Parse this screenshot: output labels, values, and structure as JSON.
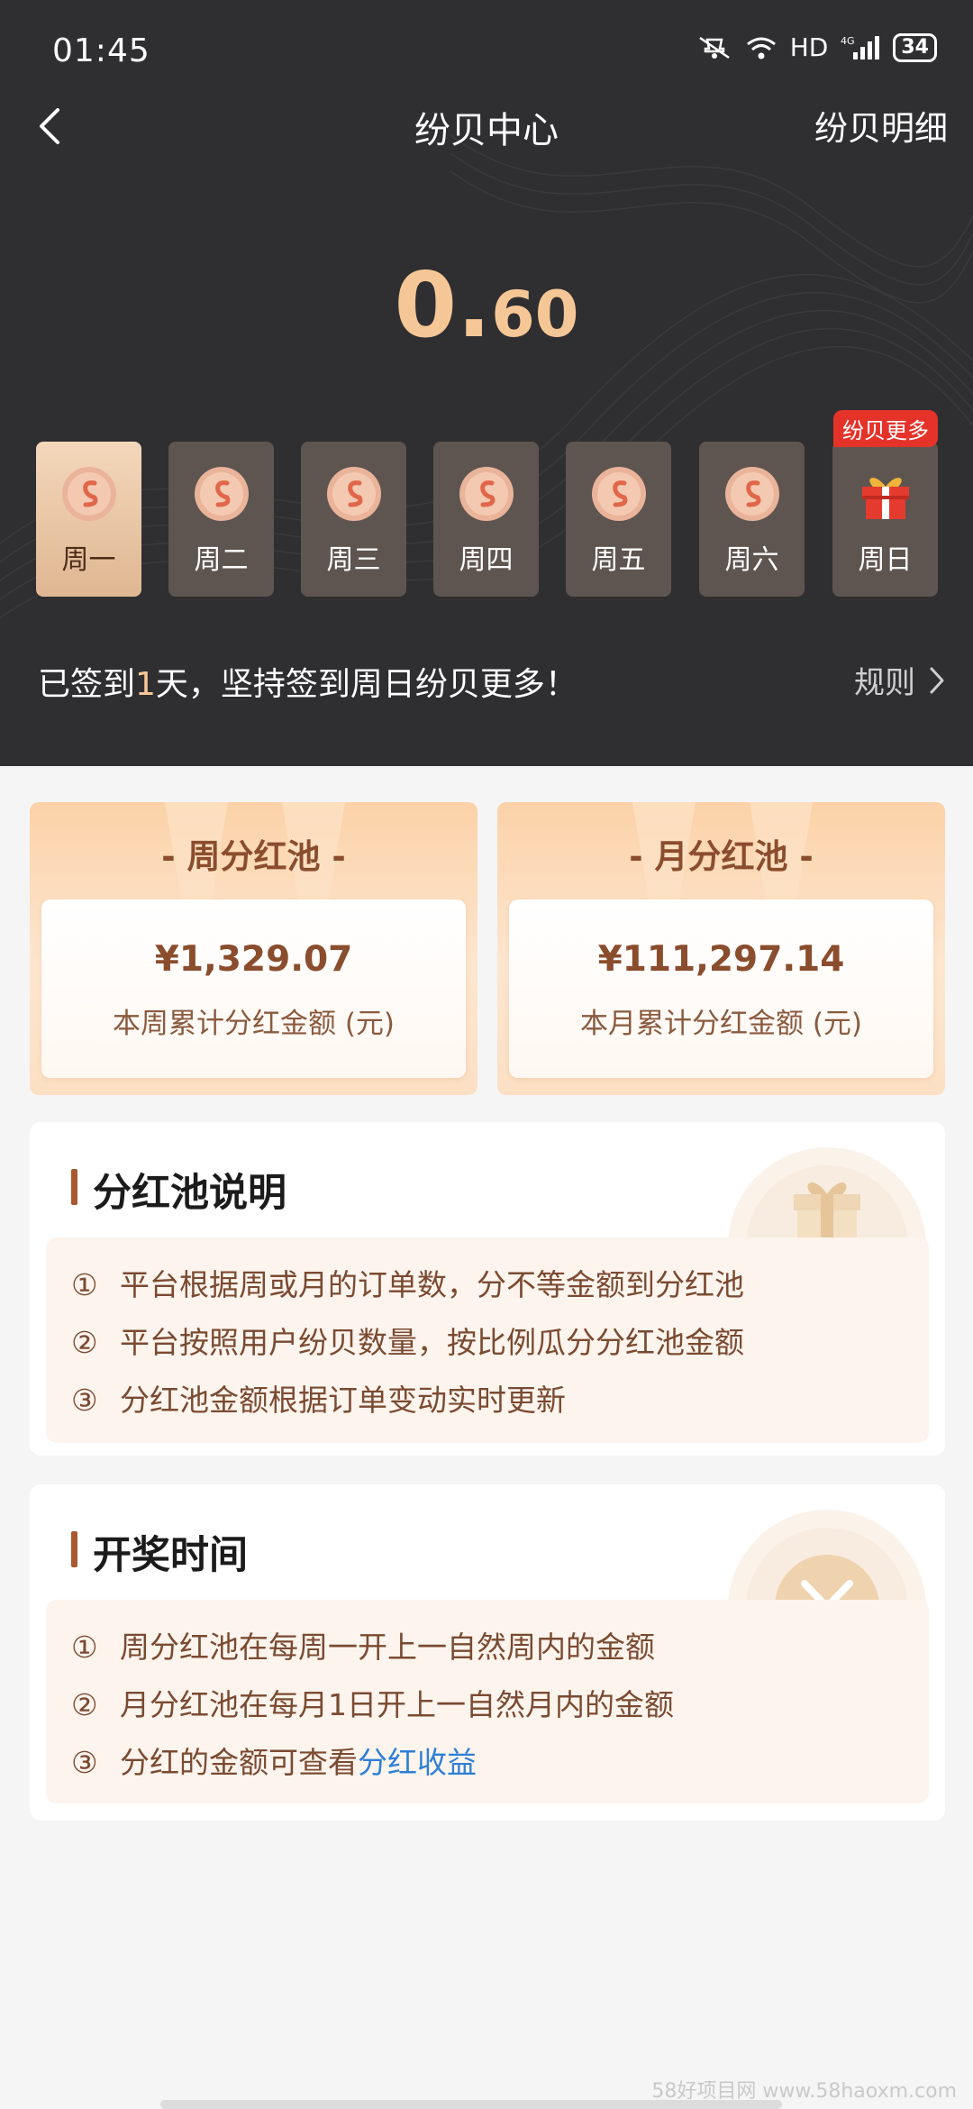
{
  "status": {
    "time": "01:45",
    "network": "HD",
    "signal_type": "4G",
    "battery": "34"
  },
  "nav": {
    "title": "纷贝中心",
    "detail_link": "纷贝明细"
  },
  "balance": {
    "integer_part": "0.",
    "decimal_part": "60"
  },
  "week": {
    "days": [
      {
        "label": "周一",
        "state": "checked",
        "icon": "coin-icon"
      },
      {
        "label": "周二",
        "state": "pending",
        "icon": "coin-icon"
      },
      {
        "label": "周三",
        "state": "pending",
        "icon": "coin-icon"
      },
      {
        "label": "周四",
        "state": "pending",
        "icon": "coin-icon"
      },
      {
        "label": "周五",
        "state": "pending",
        "icon": "coin-icon"
      },
      {
        "label": "周六",
        "state": "pending",
        "icon": "coin-icon"
      },
      {
        "label": "周日",
        "state": "pending",
        "icon": "gift-icon"
      }
    ],
    "bonus_badge": "纷贝更多"
  },
  "checkin": {
    "prefix": "已签到",
    "days": "1",
    "suffix": "天，坚持签到周日纷贝更多！",
    "rules_label": "规则"
  },
  "pools": [
    {
      "title": "- 周分红池 -",
      "amount": "¥1,329.07",
      "caption": "本周累计分红金额 (元)"
    },
    {
      "title": "- 月分红池 -",
      "amount": "¥111,297.14",
      "caption": "本月累计分红金额 (元)"
    }
  ],
  "explain": {
    "title": "分红池说明",
    "items": [
      {
        "num": "①",
        "text": "平台根据周或月的订单数，分不等金额到分红池"
      },
      {
        "num": "②",
        "text": "平台按照用户纷贝数量，按比例瓜分分红池金额"
      },
      {
        "num": "③",
        "text": "分红池金额根据订单变动实时更新"
      }
    ]
  },
  "lottery": {
    "title": "开奖时间",
    "items": [
      {
        "num": "①",
        "text": "周分红池在每周一开上一自然周内的金额"
      },
      {
        "num": "②",
        "text": "月分红池在每月1日开上一自然月内的金额"
      },
      {
        "num": "③",
        "text": "分红的金额可查看",
        "link": "分红收益"
      }
    ]
  },
  "watermark": "58好项目网 www.58haoxm.com",
  "colors": {
    "header_bg": "#2f2f31",
    "gold": "#f6c796",
    "brown": "#8a4d2d",
    "badge_red": "#e5332a",
    "link_blue": "#2f7fd6"
  }
}
